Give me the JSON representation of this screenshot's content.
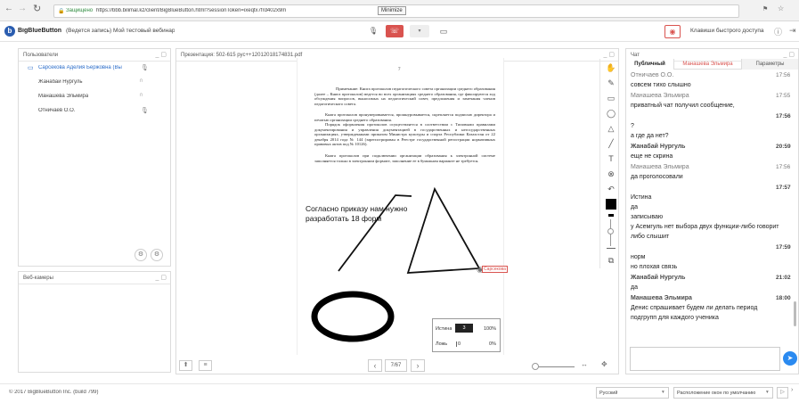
{
  "browser": {
    "back_icon": "back-arrow-icon",
    "secure_label": "Защищено",
    "url": "https://bbb.bilimal.kz/client/BigBlueButton.html?sessionToken=ixeqtx7frd402x9m",
    "minimize_tooltip": "Minimize"
  },
  "header": {
    "logo_text": "BigBlueButton",
    "meeting_title": "(Ведется запись) Мой тестовый вебинар",
    "shortcuts_label": "Клавиши быстрого доступа",
    "accent": "#d9534f"
  },
  "users_panel": {
    "title": "Пользователи",
    "users": [
      {
        "name": "Сарсекова Аделия Бержовна (Вы",
        "icon": "mic-icon",
        "selected": true
      },
      {
        "name": "Жанабай Нургуль",
        "icon": "headset-icon",
        "selected": false
      },
      {
        "name": "Манашева Эльмира",
        "icon": "headset-icon",
        "selected": false
      },
      {
        "name": "Отничаев О.О.",
        "icon": "mic-icon",
        "selected": false
      }
    ]
  },
  "webcams_panel": {
    "title": "Веб-камеры"
  },
  "presentation": {
    "title": "Презентация: 502-615 рус++12012018174831.pdf",
    "page_number": "7",
    "paragraphs": [
      "Примечание: Книга протоколов педагогического совета организации среднего образования (далее – Книга протоколов) ведется во всех организациях среднего образования, где фиксируются ход обсуждения вопросов, выносимых на педагогический совет, предложения и замечания членов педагогического совета.",
      "Книга протоколов пронумеровывается, прошнуровывается, скрепляется подписью директора и печатью организации среднего образования.",
      "Порядок оформления протоколов осуществляется в соответствии с Типовыми правилами документирования и управления документацией в государственных и негосударственных организациях, утвержденными приказом Министра культуры и спорта Республики Казахстан от 22 декабря 2014 года № 144 (зарегистрирован в Реестре государственной регистрации нормативных правовых актов под № 10126).",
      "Книга протоколов при подключении организации образования к электронной системе заполняется только в электронном формате, заполнение ее в бумажном варианте не требуется."
    ],
    "handwritten": [
      "Согласно приказу нам нужно",
      "разработать 18 форм"
    ],
    "cursor_label": "Сарсекова",
    "page_indicator": "7/67",
    "poll": {
      "rows": [
        {
          "label": "Истина",
          "count": "3",
          "percent": "100%"
        },
        {
          "label": "Ложь",
          "count": "0",
          "percent": "0%"
        }
      ]
    }
  },
  "chat": {
    "title": "Чат",
    "tabs": [
      "Публичный",
      "Манашева Эльмира",
      "Параметры"
    ],
    "messages": [
      {
        "name": "Отничаев О.О.",
        "time": "17:56",
        "bold": false,
        "lines": [
          "совсем тихо слышно"
        ]
      },
      {
        "name": "Манашева Эльмира",
        "time": "17:55",
        "bold": false,
        "lines": [
          "приватный чат получил сообщение,"
        ]
      },
      {
        "name": "",
        "time": "17:56",
        "bold": true,
        "lines": [
          "?",
          "а где да нет?"
        ]
      },
      {
        "name": "Жанабай Нургуль",
        "time": "20:59",
        "bold": true,
        "lines": [
          "еще не скрина"
        ]
      },
      {
        "name": "Манашева Эльмира",
        "time": "17:56",
        "bold": false,
        "lines": [
          "да проголосовали"
        ]
      },
      {
        "name": "",
        "time": "17:57",
        "bold": true,
        "lines": [
          "Истина",
          "да",
          "записываю",
          "у Асемгуль нет выбора двух функции-либо говорит",
          "либо слышит"
        ]
      },
      {
        "name": "",
        "time": "17:59",
        "bold": true,
        "lines": [
          "норм",
          "но плохая связь"
        ]
      },
      {
        "name": "Жанабай Нургуль",
        "time": "21:02",
        "bold": true,
        "lines": [
          "да"
        ]
      },
      {
        "name": "Манашева Эльмира",
        "time": "18:00",
        "bold": true,
        "lines": [
          "Денис спрашивает будем ли делать период",
          "подгрупп для каждого ученика"
        ]
      }
    ]
  },
  "footer": {
    "copyright": "© 2017 BigBlueButton Inc. (build 799)",
    "language": "Русский",
    "layout": "Расположение окон по умолчанию"
  }
}
